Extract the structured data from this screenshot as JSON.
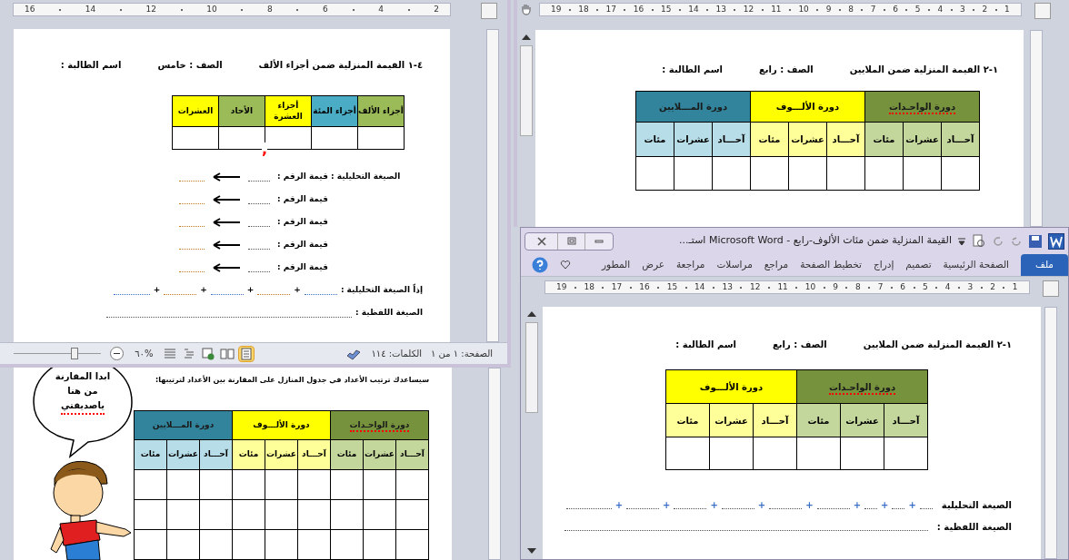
{
  "left_window": {
    "ruler": [
      "2",
      "4",
      "6",
      "8",
      "10",
      "12",
      "14",
      "16"
    ],
    "heading": {
      "title": "٤-١ القيمة المنزلية ضمن أجزاء الألف",
      "grade": "الصف : خامس",
      "student": "اسم الطالبة :"
    },
    "table": {
      "columns": [
        {
          "label": "أجزاء الألف",
          "color": "#9bbb59"
        },
        {
          "label": "أجزاء المئة",
          "color": "#4bacc6"
        },
        {
          "label": "أجزاء العشرة",
          "color": "#ffff00",
          "mark": ","
        },
        {
          "label": "الأحاد",
          "color": "#9bbb59"
        },
        {
          "label": "العشرات",
          "color": "#ffff00"
        }
      ]
    },
    "form": {
      "rows": [
        "الصيغة التحليلية : قيمة الرقم :",
        "قيمة الرقم :",
        "قيمة الرقم :",
        "قيمة الرقم :",
        "قيمة الرقم :"
      ],
      "sum_label": "إذاً الصيغة التحليلية :",
      "pluses": [
        "+",
        "+",
        "+",
        "+"
      ],
      "words_label": "الصيغة اللفظية :"
    },
    "status_bar": {
      "page": "الصفحة: ١ من ١",
      "words": "الكلمات: ١١٤",
      "views": [
        {
          "kind": "print",
          "selected": true
        },
        {
          "kind": "reading",
          "selected": false
        },
        {
          "kind": "web",
          "selected": false
        },
        {
          "kind": "outline",
          "selected": false
        },
        {
          "kind": "draft",
          "selected": false
        }
      ],
      "zoom": "%٦٠",
      "zoom_slider": {
        "level": 0.7
      }
    }
  },
  "back_window": {
    "instruction": "سيساعدك ترتيب الأعداد في جدول المنازل على المقارنة بين الأعداد لترتيبها:",
    "bubble": [
      {
        "text": "ابدا المقارنة",
        "spell_error": false
      },
      {
        "text": "من هنا",
        "spell_error": false
      },
      {
        "text": "ياصديقتي",
        "spell_error": true
      }
    ],
    "table": {
      "periods": [
        {
          "name": "دورة الواحـدات",
          "spell_error": true,
          "color": "#76923c",
          "columns": [
            {
              "label": "آحـــاد",
              "color": "#c3d69b"
            },
            {
              "label": "عشرات",
              "color": "#c3d69b"
            },
            {
              "label": "مئات",
              "color": "#c3d69b"
            }
          ]
        },
        {
          "name": "دورة الألـــوف",
          "spell_error": false,
          "color": "#ffff00",
          "columns": [
            {
              "label": "آحـــاد",
              "color": "#ffff99"
            },
            {
              "label": "عشرات",
              "color": "#ffff99"
            },
            {
              "label": "مئات",
              "color": "#ffff99"
            }
          ]
        },
        {
          "name": "دورة المـــلايين",
          "spell_error": false,
          "color": "#31849b",
          "columns": [
            {
              "label": "آحـــاد",
              "color": "#b7dde8"
            },
            {
              "label": "عشرات",
              "color": "#b7dde8"
            },
            {
              "label": "مئات",
              "color": "#b7dde8"
            }
          ]
        }
      ]
    }
  },
  "right_window": {
    "ruler": [
      "1",
      "2",
      "3",
      "4",
      "5",
      "6",
      "7",
      "8",
      "9",
      "10",
      "11",
      "12",
      "13",
      "14",
      "15",
      "16",
      "17",
      "18",
      "19"
    ],
    "heading": {
      "title": "١-٢ القيمة المنزلية ضمن الملايين",
      "grade": "الصف : رابع",
      "student": "اسم الطالبة :"
    },
    "table": {
      "periods": [
        {
          "name": "دورة الواحـدات",
          "spell_error": true,
          "color": "#76923c",
          "columns": [
            {
              "label": "آحـــاد",
              "color": "#c3d69b"
            },
            {
              "label": "عشرات",
              "color": "#c3d69b"
            },
            {
              "label": "مئات",
              "color": "#c3d69b"
            }
          ]
        },
        {
          "name": "دورة الألـــوف",
          "spell_error": false,
          "color": "#ffff00",
          "columns": [
            {
              "label": "آحـــاد",
              "color": "#ffff99"
            },
            {
              "label": "عشرات",
              "color": "#ffff99"
            },
            {
              "label": "مئات",
              "color": "#ffff99"
            }
          ]
        },
        {
          "name": "دورة المـــلايين",
          "spell_error": false,
          "color": "#31849b",
          "columns": [
            {
              "label": "آحـــاد",
              "color": "#b7dde8"
            },
            {
              "label": "عشرات",
              "color": "#b7dde8"
            },
            {
              "label": "مئات",
              "color": "#b7dde8"
            }
          ]
        }
      ]
    }
  },
  "front_window": {
    "title": "القيمة المنزلية ضمن مئات الألوف-رابع  -  Microsoft Word  استـ...",
    "tabs": [
      {
        "label": "ملف",
        "selected": true
      },
      {
        "label": "الصفحة الرئيسية",
        "selected": false
      },
      {
        "label": "تصميم",
        "selected": false
      },
      {
        "label": "إدراج",
        "selected": false
      },
      {
        "label": "تخطيط الصفحة",
        "selected": false
      },
      {
        "label": "مراجع",
        "selected": false
      },
      {
        "label": "مراسلات",
        "selected": false
      },
      {
        "label": "مراجعة",
        "selected": false
      },
      {
        "label": "عرض",
        "selected": false
      },
      {
        "label": "المطور",
        "selected": false
      }
    ],
    "ruler": [
      "1",
      "2",
      "3",
      "4",
      "5",
      "6",
      "7",
      "8",
      "9",
      "10",
      "11",
      "12",
      "13",
      "14",
      "15",
      "16",
      "17",
      "18",
      "19"
    ],
    "heading": {
      "title": "١-٢ القيمة المنزلية ضمن الملايين",
      "grade": "الصف : رابع",
      "student": "اسم الطالبة :"
    },
    "table": {
      "periods": [
        {
          "name": "دورة الواحـدات",
          "spell_error": true,
          "color": "#76923c",
          "columns": [
            {
              "label": "آحـــاد",
              "color": "#c3d69b"
            },
            {
              "label": "عشرات",
              "color": "#c3d69b"
            },
            {
              "label": "مئات",
              "color": "#c3d69b"
            }
          ]
        },
        {
          "name": "دورة الألـــوف",
          "spell_error": false,
          "color": "#ffff00",
          "columns": [
            {
              "label": "آحـــاد",
              "color": "#ffff99"
            },
            {
              "label": "عشرات",
              "color": "#ffff99"
            },
            {
              "label": "مئات",
              "color": "#ffff99"
            }
          ]
        }
      ]
    },
    "form": {
      "analytic_label": "الصيغة التحليلية",
      "pluses": [
        "+",
        "+",
        "+",
        "+",
        "+",
        "+",
        "+",
        "+"
      ],
      "words_label": "الصيغة اللفظية :"
    }
  }
}
